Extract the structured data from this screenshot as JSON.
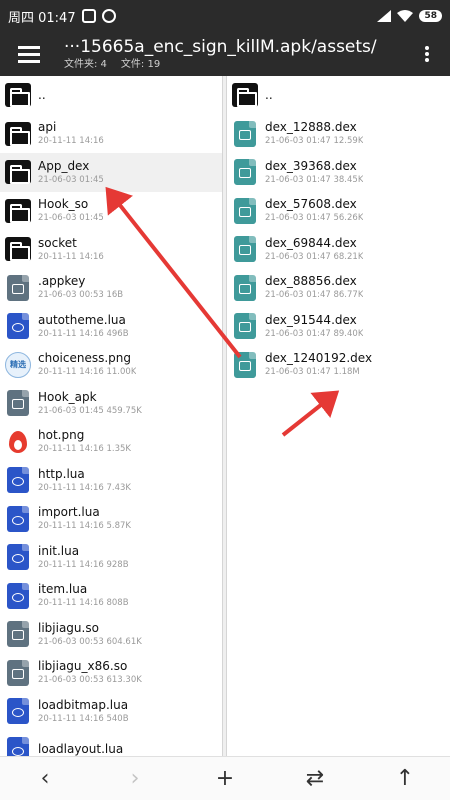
{
  "status_bar": {
    "time": "周四 01:47",
    "battery": "58"
  },
  "toolbar": {
    "path": "···15665a_enc_sign_killM.apk/assets/",
    "folders_label": "文件夹: 4",
    "files_label": "文件: 19"
  },
  "left_pane": [
    {
      "name": "..",
      "sub": "",
      "icon": "folder-icon",
      "kind": "folder"
    },
    {
      "name": "api",
      "sub": "20-11-11 14:16",
      "icon": "folder-icon",
      "kind": "folder"
    },
    {
      "name": "App_dex",
      "sub": "21-06-03 01:45",
      "icon": "folder-icon",
      "kind": "folder",
      "selected": true
    },
    {
      "name": "Hook_so",
      "sub": "21-06-03 01:45",
      "icon": "folder-icon",
      "kind": "folder"
    },
    {
      "name": "socket",
      "sub": "20-11-11 14:16",
      "icon": "folder-icon",
      "kind": "folder"
    },
    {
      "name": ".appkey",
      "sub": "21-06-03 00:53 16B",
      "icon": "file-icon",
      "kind": "gray"
    },
    {
      "name": "autotheme.lua",
      "sub": "20-11-11 14:16 496B",
      "icon": "lua-file-icon",
      "kind": "blue"
    },
    {
      "name": "choiceness.png",
      "sub": "20-11-11 14:16 11.00K",
      "icon": "image-thumbnail-icon",
      "kind": "png",
      "badge": "精选"
    },
    {
      "name": "Hook_apk",
      "sub": "21-06-03 01:45 459.75K",
      "icon": "file-icon",
      "kind": "gray"
    },
    {
      "name": "hot.png",
      "sub": "20-11-11 14:16 1.35K",
      "icon": "flame-icon",
      "kind": "flame"
    },
    {
      "name": "http.lua",
      "sub": "20-11-11 14:16 7.43K",
      "icon": "lua-file-icon",
      "kind": "blue"
    },
    {
      "name": "import.lua",
      "sub": "20-11-11 14:16 5.87K",
      "icon": "lua-file-icon",
      "kind": "blue"
    },
    {
      "name": "init.lua",
      "sub": "20-11-11 14:16 928B",
      "icon": "lua-file-icon",
      "kind": "blue"
    },
    {
      "name": "item.lua",
      "sub": "20-11-11 14:16 808B",
      "icon": "lua-file-icon",
      "kind": "blue"
    },
    {
      "name": "libjiagu.so",
      "sub": "21-06-03 00:53 604.61K",
      "icon": "file-icon",
      "kind": "gray"
    },
    {
      "name": "libjiagu_x86.so",
      "sub": "21-06-03 00:53 613.30K",
      "icon": "file-icon",
      "kind": "gray"
    },
    {
      "name": "loadbitmap.lua",
      "sub": "20-11-11 14:16 540B",
      "icon": "lua-file-icon",
      "kind": "blue"
    },
    {
      "name": "loadlayout.lua",
      "sub": "",
      "icon": "lua-file-icon",
      "kind": "blue"
    }
  ],
  "right_pane": [
    {
      "name": "..",
      "sub": "",
      "icon": "folder-icon",
      "kind": "folder"
    },
    {
      "name": "dex_12888.dex",
      "sub": "21-06-03 01:47 12.59K",
      "icon": "dex-file-icon",
      "kind": "teal"
    },
    {
      "name": "dex_39368.dex",
      "sub": "21-06-03 01:47 38.45K",
      "icon": "dex-file-icon",
      "kind": "teal"
    },
    {
      "name": "dex_57608.dex",
      "sub": "21-06-03 01:47 56.26K",
      "icon": "dex-file-icon",
      "kind": "teal"
    },
    {
      "name": "dex_69844.dex",
      "sub": "21-06-03 01:47 68.21K",
      "icon": "dex-file-icon",
      "kind": "teal"
    },
    {
      "name": "dex_88856.dex",
      "sub": "21-06-03 01:47 86.77K",
      "icon": "dex-file-icon",
      "kind": "teal"
    },
    {
      "name": "dex_91544.dex",
      "sub": "21-06-03 01:47 89.40K",
      "icon": "dex-file-icon",
      "kind": "teal"
    },
    {
      "name": "dex_1240192.dex",
      "sub": "21-06-03 01:47 1.18M",
      "icon": "dex-file-icon",
      "kind": "teal"
    }
  ],
  "bottom_bar": {
    "back": "‹",
    "forward": "›",
    "add": "+",
    "swap": "⇄",
    "up": "↑"
  },
  "colors": {
    "bar_dark": "#2b2b2b",
    "folder": "#111111",
    "lua_blue": "#2b55c8",
    "file_gray": "#5f7280",
    "dex_teal": "#3f9a9a",
    "annotation_arrow": "#e53935"
  }
}
